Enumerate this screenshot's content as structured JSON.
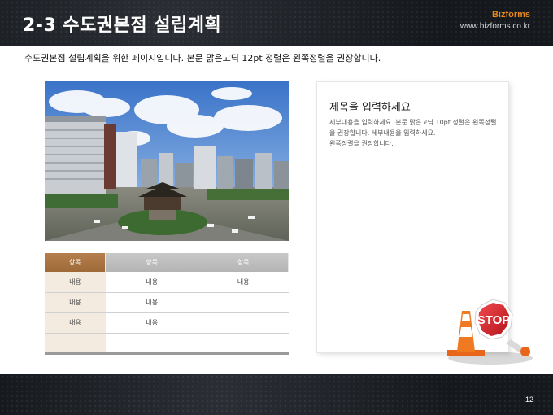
{
  "header": {
    "title": "2-3 수도권본점 설립계획",
    "brand_name": "Bizforms",
    "brand_url": "www.bizforms.co.kr"
  },
  "subtitle": "수도권본점 설립계획을 위한 페이지입니다. 본문 맑은고딕 12pt 정렬은 왼쪽정렬을 권장합니다.",
  "table": {
    "headers": [
      "항목",
      "항목",
      "항목"
    ],
    "rows": [
      [
        "내용",
        "내용",
        "내용"
      ],
      [
        "내용",
        "내용",
        ""
      ],
      [
        "내용",
        "내용",
        ""
      ],
      [
        "",
        "",
        ""
      ]
    ]
  },
  "textbox": {
    "heading": "제목을 입력하세요",
    "body_line1": "세부내용을 입력하세요. 본문 맑은고딕 10pt 정렬은 왼쪽정렬을 권장합니다. 세부내용을 입력하세요.",
    "body_line2": "왼쪽정렬을 권장합니다."
  },
  "stop_sign": {
    "text": "STOP",
    "color": "#d81f26"
  },
  "footer": {
    "page_number": "12"
  },
  "colors": {
    "accent": "#e8891c",
    "table_first_header": "#a8733f",
    "table_header": "#bdbdbd"
  }
}
